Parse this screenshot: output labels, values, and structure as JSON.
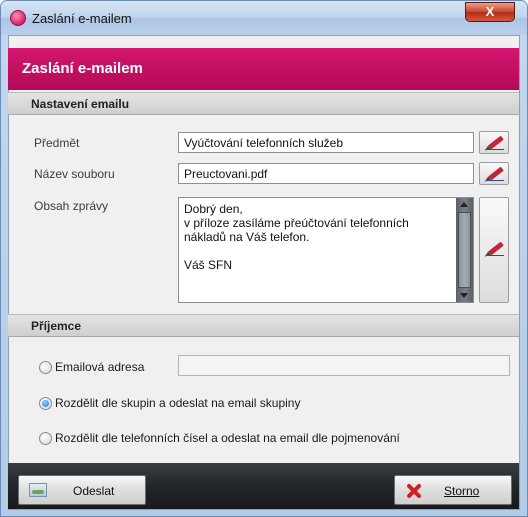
{
  "window": {
    "title": "Zaslání e-mailem",
    "close_glyph": "X"
  },
  "banner": {
    "title": "Zaslání e-mailem"
  },
  "email_settings": {
    "header": "Nastavení emailu",
    "subject_label": "Předmět",
    "subject_value": "Vyúčtování telefonních služeb",
    "filename_label": "Název souboru",
    "filename_value": "Preuctovani.pdf",
    "body_label": "Obsah zprávy",
    "body_text": "Dobrý den,\nv příloze zasíláme přeúčtování telefonních nákladů na Váš telefon.\n\nVáš SFN"
  },
  "recipient": {
    "header": "Příjemce",
    "options": [
      {
        "label": "Emailová adresa",
        "checked": false
      },
      {
        "label": "Rozdělit dle skupin a odeslat na email skupiny",
        "checked": true
      },
      {
        "label": "Rozdělit dle telefonních čísel a odeslat na email dle pojmenování",
        "checked": false
      }
    ],
    "email_value": ""
  },
  "footer": {
    "send_label": "Odeslat",
    "cancel_label": "Storno"
  },
  "colors": {
    "banner": "#c80f63",
    "footer": "#22252a"
  },
  "icons": [
    "app-icon",
    "close-icon",
    "pen-icon",
    "send-mail-icon",
    "cancel-x-icon"
  ]
}
